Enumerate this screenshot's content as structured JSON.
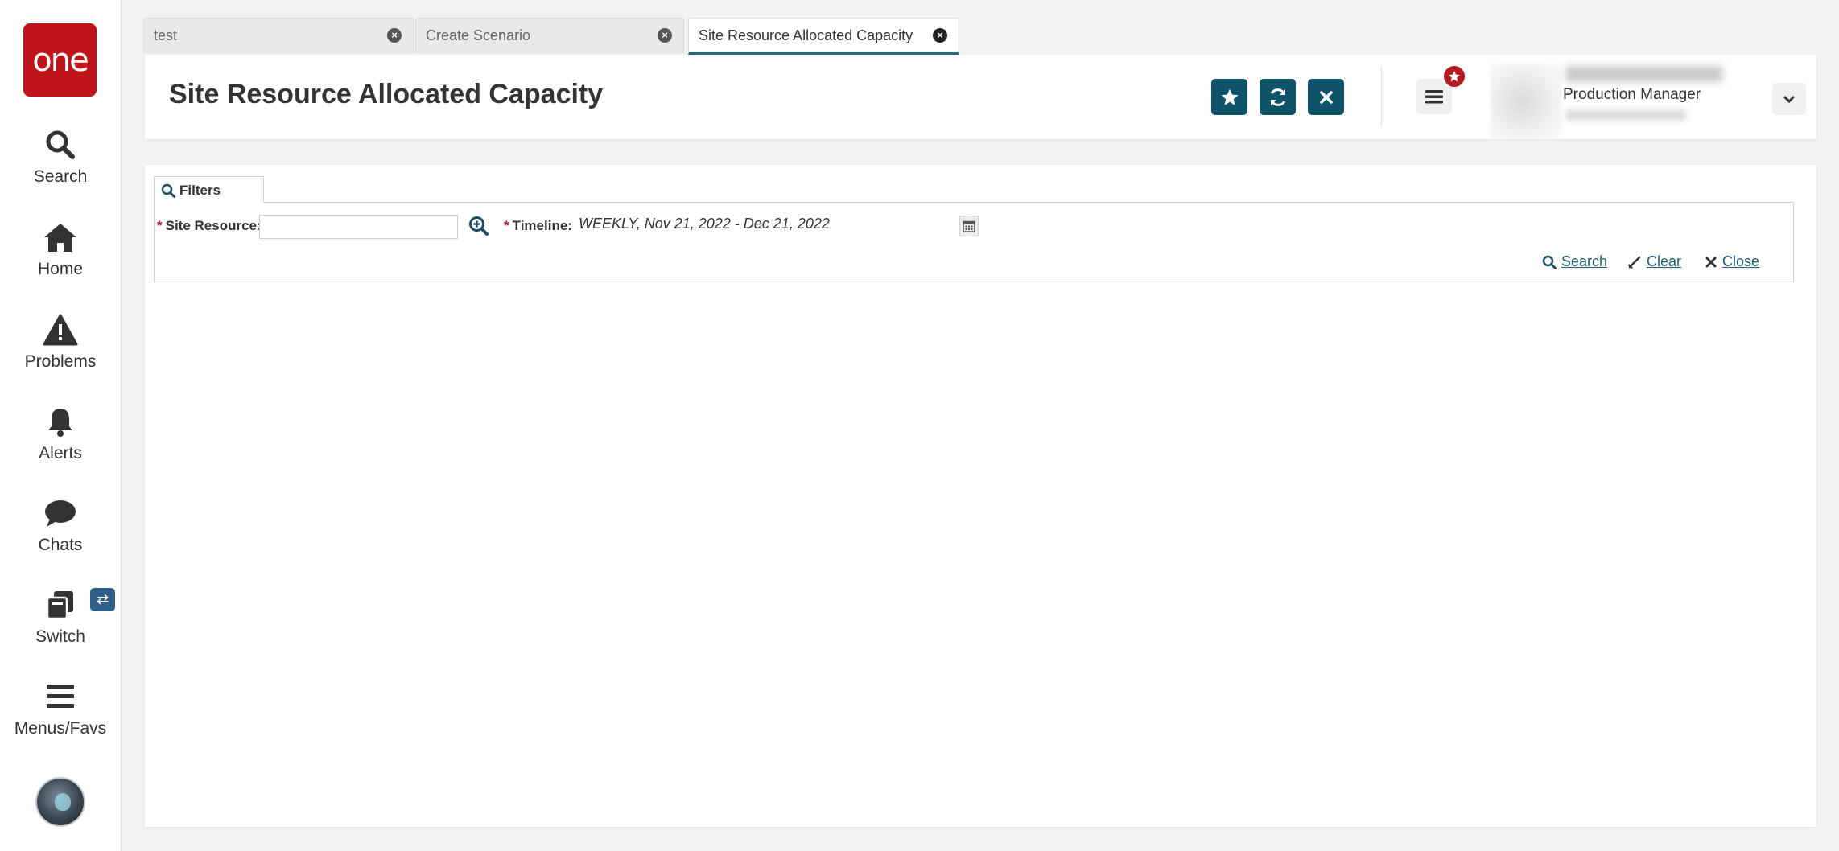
{
  "app": {
    "logo_text": "one",
    "brand_color": "#c0141b",
    "accent_color": "#0e5367"
  },
  "sidebar": {
    "items": [
      {
        "label": "Search",
        "icon": "search-icon"
      },
      {
        "label": "Home",
        "icon": "home-icon"
      },
      {
        "label": "Problems",
        "icon": "warning-icon"
      },
      {
        "label": "Alerts",
        "icon": "bell-icon"
      },
      {
        "label": "Chats",
        "icon": "chat-icon"
      },
      {
        "label": "Switch",
        "icon": "switch-icon"
      },
      {
        "label": "Menus/Favs",
        "icon": "menu-icon"
      }
    ],
    "switch_badge_icon": "swap-arrows-icon"
  },
  "tabs": [
    {
      "label": "test",
      "active": false
    },
    {
      "label": "Create Scenario",
      "active": false
    },
    {
      "label": "Site Resource Allocated Capacity",
      "active": true
    }
  ],
  "header": {
    "title": "Site Resource Allocated Capacity",
    "buttons": [
      "star-icon",
      "refresh-icon",
      "close-icon"
    ],
    "user": {
      "role": "Production Manager"
    }
  },
  "filters": {
    "tab_label": "Filters",
    "site_resource": {
      "label": "Site Resource:",
      "value": ""
    },
    "timeline": {
      "label": "Timeline:",
      "value": "WEEKLY, Nov 21, 2022 - Dec 21, 2022"
    },
    "actions": {
      "search": "Search",
      "clear": "Clear",
      "close": "Close"
    }
  }
}
